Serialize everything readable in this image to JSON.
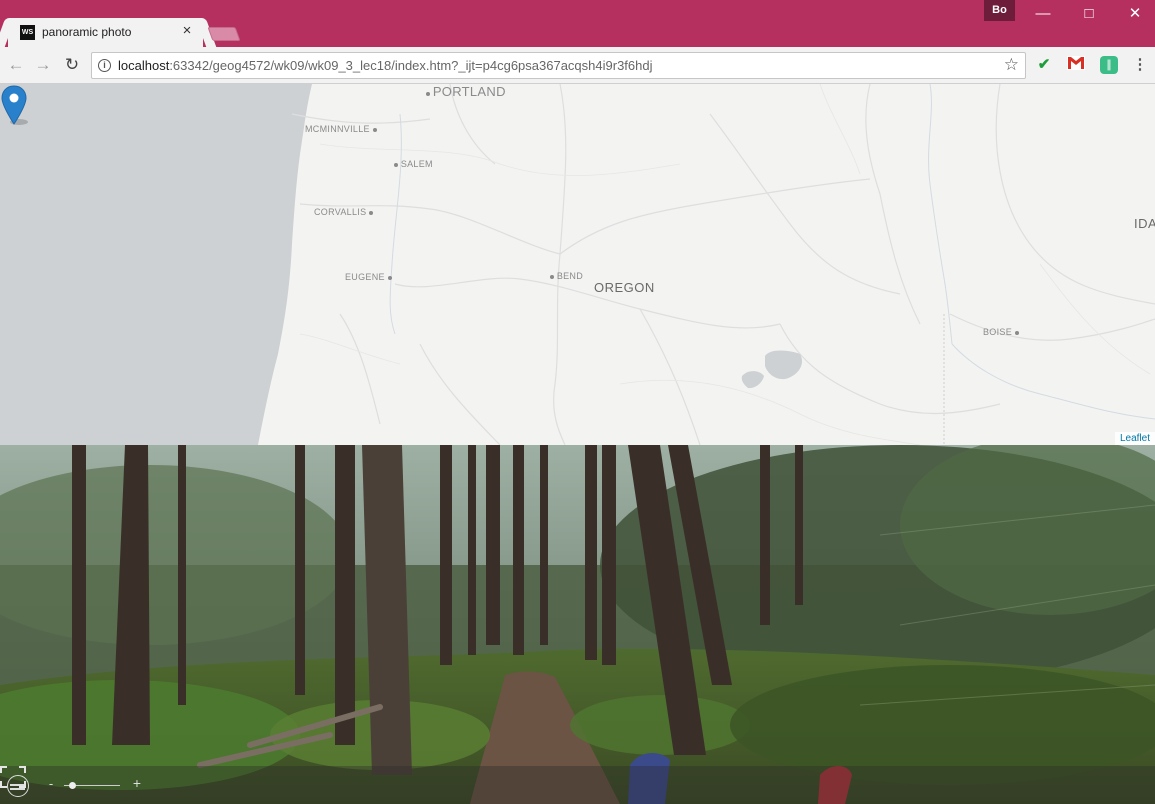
{
  "browser": {
    "tab_title": "panoramic photo",
    "tab_favicon": "WS",
    "profile": "Bo",
    "url_host": "localhost",
    "url_rest": ":63342/geog4572/wk09/wk09_3_lec18/index.htm?_ijt=p4cg6psa367acqsh4i9r3f6hdj",
    "icons": [
      "back-icon",
      "forward-icon",
      "reload-icon",
      "info-icon",
      "star-icon",
      "menu-icon"
    ],
    "colors": {
      "titlebar": "#b5305f",
      "toolbar": "#f2f2f2"
    }
  },
  "map": {
    "cities": [
      {
        "id": "portland",
        "label": "PORTLAND"
      },
      {
        "id": "mcminnville",
        "label": "MCMINNVILLE"
      },
      {
        "id": "salem",
        "label": "SALEM"
      },
      {
        "id": "corvallis",
        "label": "CORVALLIS"
      },
      {
        "id": "eugene",
        "label": "EUGENE"
      },
      {
        "id": "bend",
        "label": "BEND"
      },
      {
        "id": "boise",
        "label": "BOISE"
      }
    ],
    "state_label": "OREGON",
    "edge_label": "IDA",
    "attribution": "Leaflet",
    "marker": "map-marker-icon"
  },
  "panorama": {
    "zoom_out": "-",
    "zoom_in": "+",
    "zoom_level": 0.1
  }
}
